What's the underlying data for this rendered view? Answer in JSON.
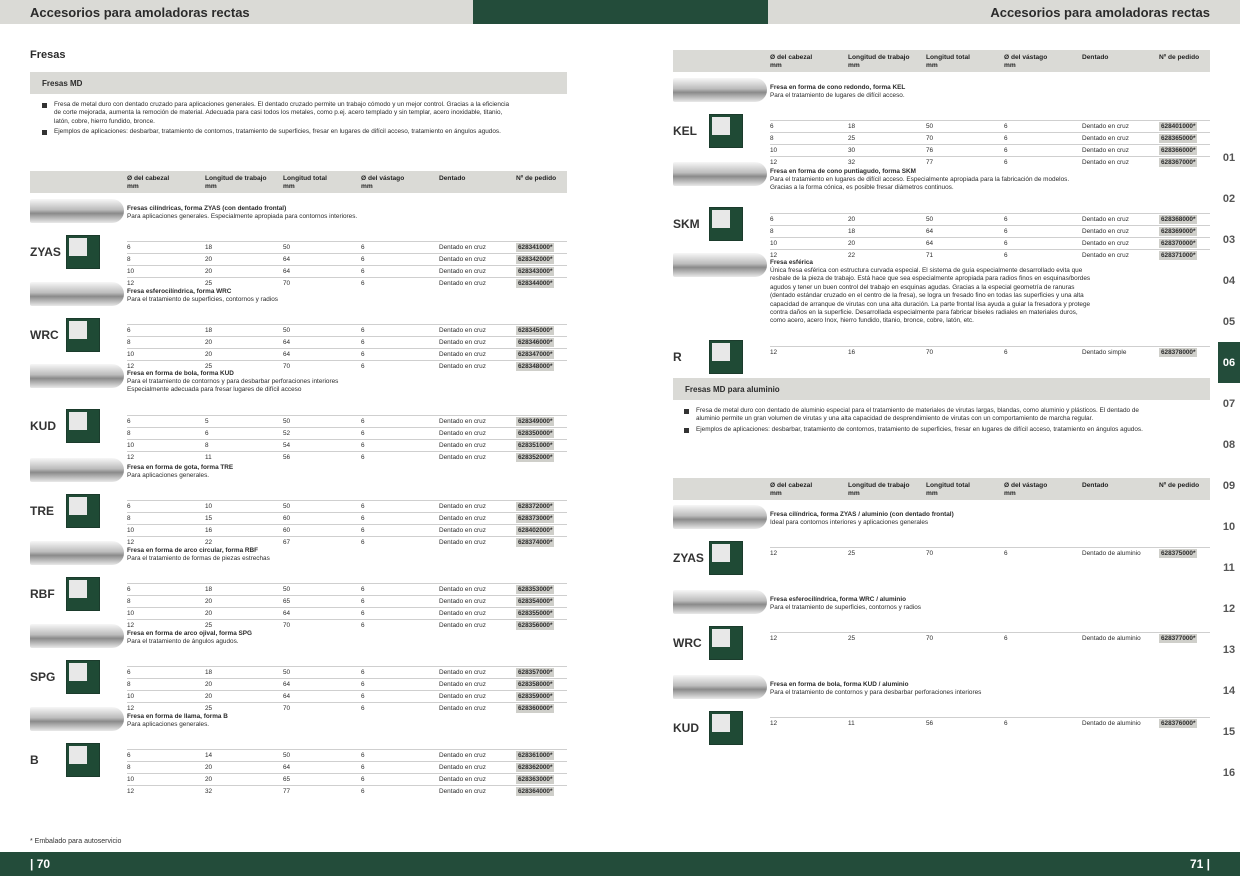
{
  "header": {
    "left_title": "Accesorios para amoladoras rectas",
    "right_title": "Accesorios para amoladoras rectas"
  },
  "footer": {
    "left_page": "| 70",
    "right_page": "71 |",
    "footnote": "* Embalado para autoservicio"
  },
  "left": {
    "title": "Fresas",
    "section": "Fresas MD",
    "bullets": [
      "Fresa de metal duro con dentado cruzado para aplicaciones generales. El dentado cruzado permite un trabajo cómodo y un mejor control. Gracias a la eficiencia de corte mejorada, aumenta la remoción de material. Adecuada para casi todos los metales, como p.ej. acero templado y sin templar, acero inoxidable, titanio, latón, cobre, hierro fundido, bronce.",
      "Ejemplos de aplicaciones: desbarbar, tratamiento de contornos, tratamiento de superficies, fresar en lugares de difícil acceso, tratamiento en ángulos agudos."
    ],
    "columns": [
      "Ø del cabezal mm",
      "Longitud de trabajo mm",
      "Longitud total mm",
      "Ø del vástago mm",
      "Dentado",
      "Nº de pedido"
    ],
    "products": [
      {
        "code": "ZYAS",
        "title": "Fresas cilíndricas, forma ZYAS (con dentado frontal)",
        "desc": [
          "Para aplicaciones generales. Especialmente apropiada para contornos interiores."
        ],
        "rows": [
          [
            "6",
            "18",
            "50",
            "6",
            "Dentado en cruz",
            "628341000*"
          ],
          [
            "8",
            "20",
            "64",
            "6",
            "Dentado en cruz",
            "628342000*"
          ],
          [
            "10",
            "20",
            "64",
            "6",
            "Dentado en cruz",
            "628343000*"
          ],
          [
            "12",
            "25",
            "70",
            "6",
            "Dentado en cruz",
            "628344000*"
          ]
        ]
      },
      {
        "code": "WRC",
        "title": "Fresa esferocilíndrica, forma WRC",
        "desc": [
          "Para el tratamiento de superficies, contornos y radios"
        ],
        "rows": [
          [
            "6",
            "18",
            "50",
            "6",
            "Dentado en cruz",
            "628345000*"
          ],
          [
            "8",
            "20",
            "64",
            "6",
            "Dentado en cruz",
            "628346000*"
          ],
          [
            "10",
            "20",
            "64",
            "6",
            "Dentado en cruz",
            "628347000*"
          ],
          [
            "12",
            "25",
            "70",
            "6",
            "Dentado en cruz",
            "628348000*"
          ]
        ]
      },
      {
        "code": "KUD",
        "title": "Fresa en forma de bola, forma KUD",
        "desc": [
          "Para el tratamiento de contornos y para desbarbar perforaciones interiores",
          "Especialmente adecuada para fresar lugares de difícil acceso"
        ],
        "rows": [
          [
            "6",
            "5",
            "50",
            "6",
            "Dentado en cruz",
            "628349000*"
          ],
          [
            "8",
            "6",
            "52",
            "6",
            "Dentado en cruz",
            "628350000*"
          ],
          [
            "10",
            "8",
            "54",
            "6",
            "Dentado en cruz",
            "628351000*"
          ],
          [
            "12",
            "11",
            "56",
            "6",
            "Dentado en cruz",
            "628352000*"
          ]
        ]
      },
      {
        "code": "TRE",
        "title": "Fresa en forma de gota, forma TRE",
        "desc": [
          "Para aplicaciones generales."
        ],
        "rows": [
          [
            "6",
            "10",
            "50",
            "6",
            "Dentado en cruz",
            "628372000*"
          ],
          [
            "8",
            "15",
            "60",
            "6",
            "Dentado en cruz",
            "628373000*"
          ],
          [
            "10",
            "16",
            "60",
            "6",
            "Dentado en cruz",
            "628402000*"
          ],
          [
            "12",
            "22",
            "67",
            "6",
            "Dentado en cruz",
            "628374000*"
          ]
        ]
      },
      {
        "code": "RBF",
        "title": "Fresa en forma de arco circular, forma RBF",
        "desc": [
          "Para el tratamiento de formas de piezas estrechas"
        ],
        "rows": [
          [
            "6",
            "18",
            "50",
            "6",
            "Dentado en cruz",
            "628353000*"
          ],
          [
            "8",
            "20",
            "65",
            "6",
            "Dentado en cruz",
            "628354000*"
          ],
          [
            "10",
            "20",
            "64",
            "6",
            "Dentado en cruz",
            "628355000*"
          ],
          [
            "12",
            "25",
            "70",
            "6",
            "Dentado en cruz",
            "628356000*"
          ]
        ]
      },
      {
        "code": "SPG",
        "title": "Fresa en forma de arco ojival, forma SPG",
        "desc": [
          "Para el tratamiento de ángulos agudos."
        ],
        "rows": [
          [
            "6",
            "18",
            "50",
            "6",
            "Dentado en cruz",
            "628357000*"
          ],
          [
            "8",
            "20",
            "64",
            "6",
            "Dentado en cruz",
            "628358000*"
          ],
          [
            "10",
            "20",
            "64",
            "6",
            "Dentado en cruz",
            "628359000*"
          ],
          [
            "12",
            "25",
            "70",
            "6",
            "Dentado en cruz",
            "628360000*"
          ]
        ]
      },
      {
        "code": "B",
        "title": "Fresa en forma de llama, forma B",
        "desc": [
          "Para aplicaciones generales."
        ],
        "rows": [
          [
            "6",
            "14",
            "50",
            "6",
            "Dentado en cruz",
            "628361000*"
          ],
          [
            "8",
            "20",
            "64",
            "6",
            "Dentado en cruz",
            "628362000*"
          ],
          [
            "10",
            "20",
            "65",
            "6",
            "Dentado en cruz",
            "628363000*"
          ],
          [
            "12",
            "32",
            "77",
            "6",
            "Dentado en cruz",
            "628364000*"
          ]
        ]
      }
    ]
  },
  "right": {
    "columns": [
      "Ø del cabezal mm",
      "Longitud de trabajo mm",
      "Longitud total mm",
      "Ø del vástago mm",
      "Dentado",
      "Nº de pedido"
    ],
    "products": [
      {
        "code": "KEL",
        "title": "Fresa en forma de cono redondo, forma KEL",
        "desc": [
          "Para el tratamiento de lugares de difícil acceso."
        ],
        "rows": [
          [
            "6",
            "18",
            "50",
            "6",
            "Dentado en cruz",
            "628401000*"
          ],
          [
            "8",
            "25",
            "70",
            "6",
            "Dentado en cruz",
            "628365000*"
          ],
          [
            "10",
            "30",
            "76",
            "6",
            "Dentado en cruz",
            "628366000*"
          ],
          [
            "12",
            "32",
            "77",
            "6",
            "Dentado en cruz",
            "628367000*"
          ]
        ]
      },
      {
        "code": "SKM",
        "title": "Fresa en forma de cono puntiagudo, forma SKM",
        "desc": [
          "Para el tratamiento en lugares de difícil acceso. Especialmente apropiada para la fabricación de modelos.",
          "Gracias a la forma cónica, es posible fresar diámetros continuos."
        ],
        "rows": [
          [
            "6",
            "20",
            "50",
            "6",
            "Dentado en cruz",
            "628368000*"
          ],
          [
            "8",
            "18",
            "64",
            "6",
            "Dentado en cruz",
            "628369000*"
          ],
          [
            "10",
            "20",
            "64",
            "6",
            "Dentado en cruz",
            "628370000*"
          ],
          [
            "12",
            "22",
            "71",
            "6",
            "Dentado en cruz",
            "628371000*"
          ]
        ]
      },
      {
        "code": "R",
        "title": "Fresa esférica",
        "desc": [
          "Única fresa esférica con estructura curvada especial. El sistema de guía especialmente desarrollado evita que",
          "resbale de la pieza de trabajo. Está hace que sea especialmente apropiada para radios finos en esquinas/bordes",
          "agudos y tener un buen control del trabajo en esquinas agudas. Gracias a la especial geometría de ranuras",
          "(dentado estándar cruzado en el centro de la fresa), se logra un fresado fino en todas las superficies y una alta",
          "capacidad de arranque de virutas con una alta duración. La parte frontal lisa ayuda a guiar la fresadora y protege",
          "contra daños en la superficie. Desarrollada especialmente para fabricar biseles radiales en materiales duros,",
          "como acero, acero Inox, hierro fundido, titanio, bronce, cobre, latón, etc."
        ],
        "rows": [
          [
            "12",
            "16",
            "70",
            "6",
            "Dentado simple",
            "628378000*"
          ]
        ]
      }
    ],
    "section2": "Fresas MD para aluminio",
    "bullets2": [
      "Fresa de metal duro con dentado de aluminio especial para el tratamiento de materiales de virutas largas, blandas, como aluminio y plásticos. El dentado de aluminio permite un gran volumen de virutas y una alta capacidad de desprendimiento de virutas con un comportamiento de marcha regular.",
      "Ejemplos de aplicaciones: desbarbar, tratamiento de contornos, tratamiento de superficies, fresar en lugares de difícil acceso, tratamiento en ángulos agudos."
    ],
    "products2": [
      {
        "code": "ZYAS",
        "title": "Fresa cilíndrica, forma ZYAS / aluminio (con dentado frontal)",
        "desc": [
          "Ideal para contornos interiores y aplicaciones generales"
        ],
        "rows": [
          [
            "12",
            "25",
            "70",
            "6",
            "Dentado de aluminio",
            "628375000*"
          ]
        ]
      },
      {
        "code": "WRC",
        "title": "Fresa esferocilíndrica, forma WRC / aluminio",
        "desc": [
          "Para el tratamiento de superficies, contornos y radios"
        ],
        "rows": [
          [
            "12",
            "25",
            "70",
            "6",
            "Dentado de aluminio",
            "628377000*"
          ]
        ]
      },
      {
        "code": "KUD",
        "title": "Fresa en forma de bola, forma KUD / aluminio",
        "desc": [
          "Para el tratamiento de contornos y para desbarbar perforaciones interiores"
        ],
        "rows": [
          [
            "12",
            "11",
            "56",
            "6",
            "Dentado de aluminio",
            "628376000*"
          ]
        ]
      }
    ]
  },
  "tabs": [
    "01",
    "02",
    "03",
    "04",
    "05",
    "06",
    "07",
    "08",
    "09",
    "10",
    "11",
    "12",
    "13",
    "14",
    "15",
    "16"
  ],
  "active_tab": "06"
}
